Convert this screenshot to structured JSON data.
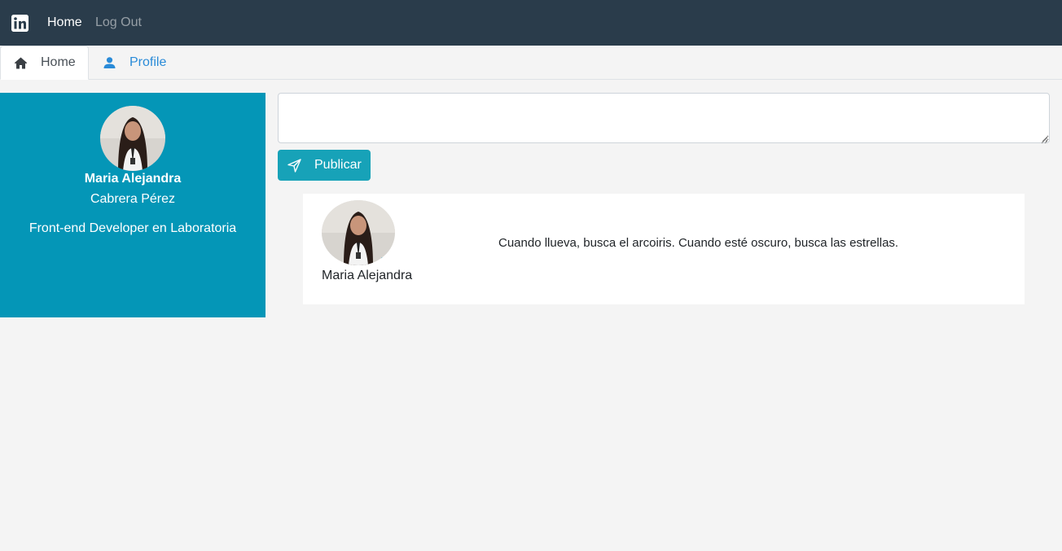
{
  "navbar": {
    "brand_icon": "linkedin-icon",
    "links": [
      "Home",
      "Log Out"
    ]
  },
  "tabs": [
    {
      "label": "Home",
      "icon": "home-icon",
      "active": true
    },
    {
      "label": "Profile",
      "icon": "user-icon",
      "active": false
    }
  ],
  "profile": {
    "name": "Maria Alejandra",
    "lastname": "Cabrera Pérez",
    "title": "Front-end Developer en Laboratoria",
    "avatar_icon": "avatar-photo"
  },
  "composer": {
    "value": "",
    "button_label": "Publicar",
    "button_icon": "send-icon"
  },
  "posts": [
    {
      "author": "Maria Alejandra",
      "text": "Cuando llueva, busca el arcoiris. Cuando esté oscuro, busca las estrellas."
    }
  ],
  "colors": {
    "navbar": "#2a3c4b",
    "profile_card": "#0496b7",
    "button": "#17a2b8",
    "link": "#2a8bd8",
    "background": "#f4f4f4"
  }
}
